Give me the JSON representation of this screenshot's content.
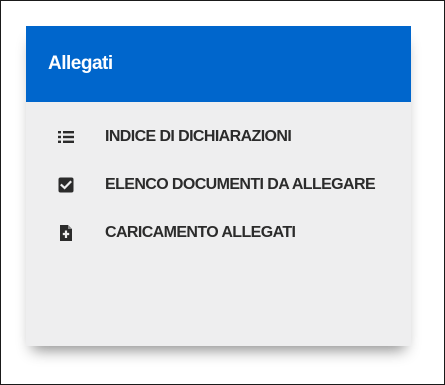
{
  "panel": {
    "title": "Allegati",
    "header_color": "#0066cc",
    "items": [
      {
        "label": "INDICE DI DICHIARAZIONI",
        "icon": "list-icon"
      },
      {
        "label": "ELENCO DOCUMENTI DA ALLEGARE",
        "icon": "checkbox-checked-icon"
      },
      {
        "label": "CARICAMENTO ALLEGATI",
        "icon": "file-upload-icon"
      }
    ]
  }
}
